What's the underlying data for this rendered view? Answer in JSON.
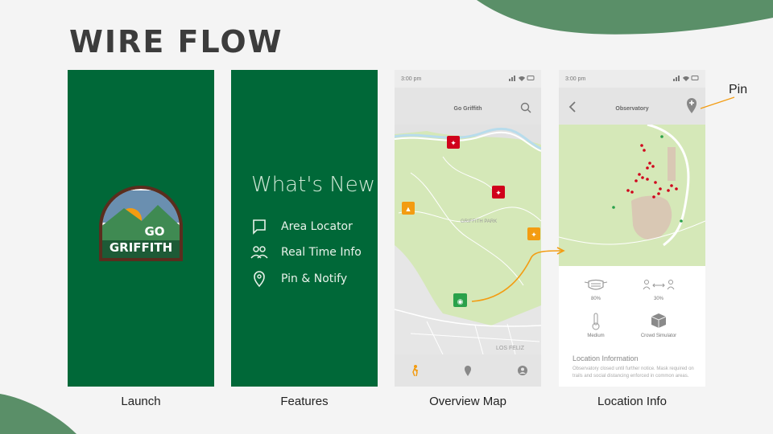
{
  "page": {
    "title": "WIRE FLOW"
  },
  "colors": {
    "brand_green": "#006838",
    "accent_orange": "#f39c12",
    "marker_red": "#d0021b",
    "map_green": "#d5e8b8"
  },
  "screens": [
    {
      "caption": "Launch",
      "logo": {
        "line1": "GO",
        "line2": "GRIFFITH"
      }
    },
    {
      "caption": "Features",
      "heading": "What's New",
      "items": [
        {
          "icon": "map-sign-icon",
          "label": "Area Locator"
        },
        {
          "icon": "people-icon",
          "label": "Real Time Info"
        },
        {
          "icon": "location-pin-icon",
          "label": "Pin & Notify"
        }
      ]
    },
    {
      "caption": "Overview Map",
      "status": {
        "time": "3:00 pm"
      },
      "app_title": "Go Griffith",
      "map_labels": {
        "park": "GRIFFITH PARK",
        "area": "LOS FELIZ"
      },
      "nav": [
        "hiker-icon",
        "location-icon",
        "profile-icon"
      ]
    },
    {
      "caption": "Location Info",
      "status": {
        "time": "3:00 pm"
      },
      "app_title": "Observatory",
      "stats": [
        {
          "icon": "mask-icon",
          "label": "80%"
        },
        {
          "icon": "distance-icon",
          "label": "30%"
        },
        {
          "icon": "thermometer-icon",
          "label": "Medium"
        },
        {
          "icon": "cube-icon",
          "label": "Crowd Simulator"
        }
      ],
      "section_title": "Location Information",
      "section_text": "Observatory closed until further notice. Mask required on trails and social distancing enforced in common areas."
    }
  ],
  "annotation": {
    "pin_label": "Pin"
  }
}
